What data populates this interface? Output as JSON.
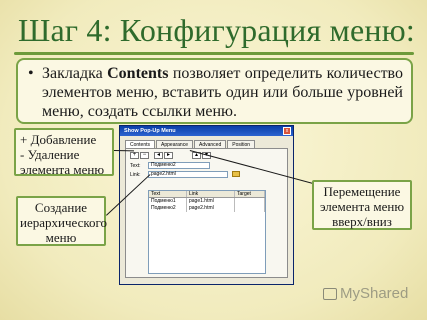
{
  "slide": {
    "title": "Шаг 4: Конфигурация меню:",
    "bullet_parts": {
      "before": "Закладка ",
      "bold": "Contents",
      "after": " позволяет определить количество элементов меню, вставить один или больше уровней меню, создать ссылки меню."
    }
  },
  "dialog": {
    "title": "Show Pop-Up Menu",
    "close_label": "x",
    "tabs": [
      "Contents",
      "Appearance",
      "Advanced",
      "Position"
    ],
    "add_label": "+",
    "remove_label": "−",
    "text_label": "Text:",
    "text_value": "Подменю2",
    "link_label": "Link:",
    "link_value": "page2.html",
    "columns": [
      "Text",
      "Link",
      "Target"
    ],
    "rows": [
      [
        "Подменю1",
        "page1.html",
        ""
      ],
      [
        "Подменю2",
        "page2.html",
        ""
      ]
    ]
  },
  "callouts": {
    "add_remove": "+ Добавление\n- Удаление элемента меню",
    "hierarchy": "Создание иерархического меню",
    "move": "Перемещение элемента меню вверх/вниз"
  },
  "watermark": "MyShared"
}
